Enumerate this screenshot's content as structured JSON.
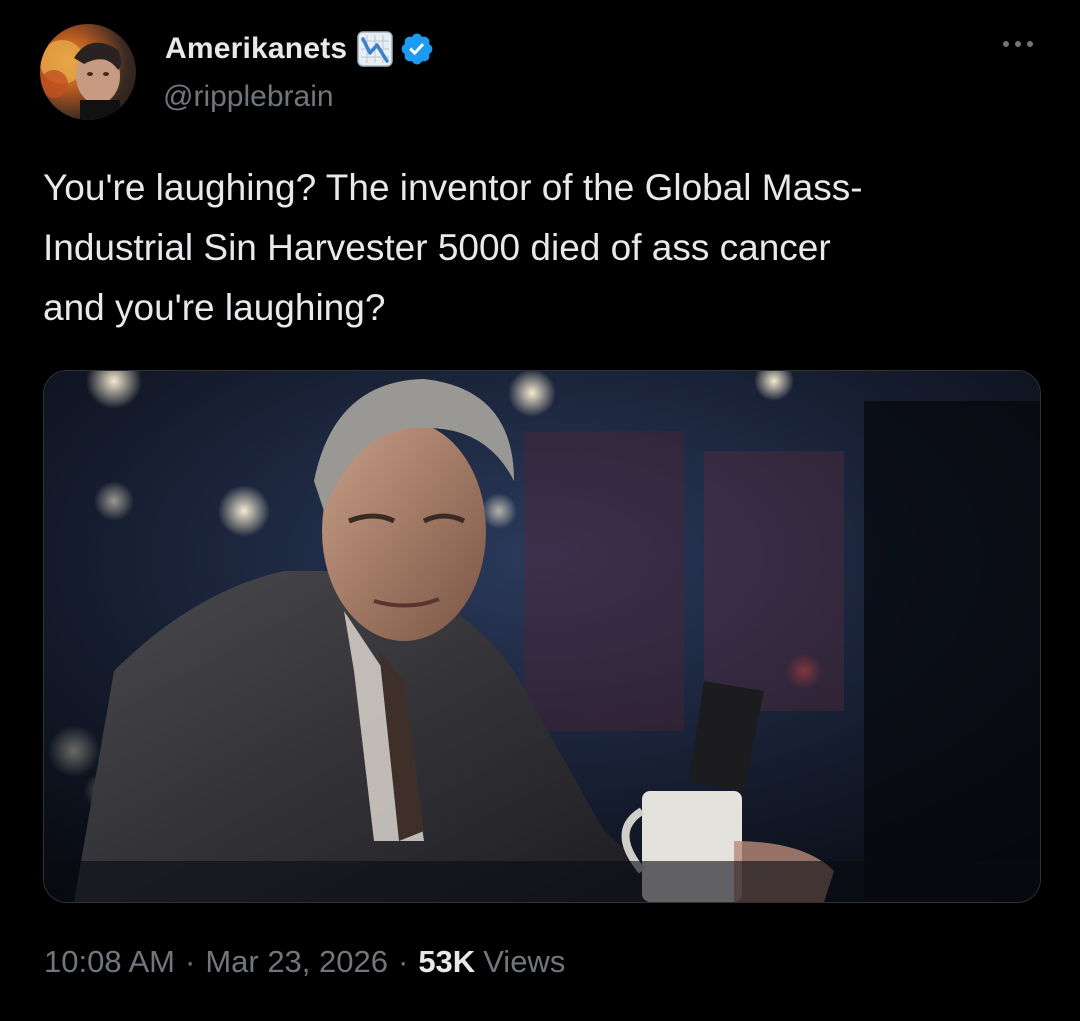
{
  "author": {
    "display_name": "Amerikanets",
    "handle": "@ripplebrain",
    "avatar_icon": "profile-photo",
    "badges": [
      "chart-decreasing-emoji",
      "verified-badge"
    ]
  },
  "colors": {
    "verified": "#1d9bf0",
    "text_primary": "#e7e9ea",
    "text_secondary": "#71767b",
    "background": "#000000"
  },
  "tweet": {
    "text": "You're laughing? The inventor of the Global Mass-\nIndustrial Sin Harvester 5000 died of ass cancer\nand you're laughing?",
    "media_description_icon": "photo-attachment"
  },
  "meta": {
    "time": "10:08 AM",
    "separator": "·",
    "date": "Mar 23, 2026",
    "views_count": "53K",
    "views_label": "Views"
  },
  "menu": {
    "more_icon": "more-options-icon"
  }
}
